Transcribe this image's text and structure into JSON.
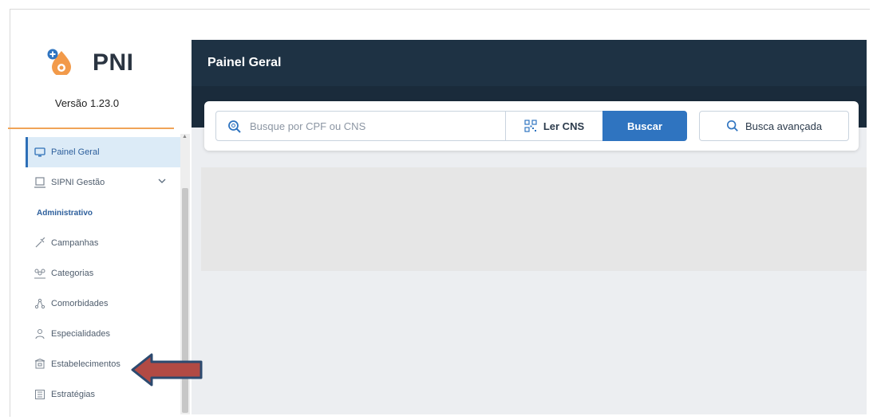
{
  "app": {
    "logo_text": "PNI",
    "version": "Versão 1.23.0"
  },
  "sidebar": {
    "items": [
      {
        "label": "Painel Geral",
        "icon": "monitor-icon",
        "active": true
      },
      {
        "label": "SIPNI Gestão",
        "icon": "laptop-icon",
        "expandable": true
      },
      {
        "label": "Campanhas",
        "icon": "syringe-icon"
      },
      {
        "label": "Categorias",
        "icon": "people-group-icon"
      },
      {
        "label": "Comorbidades",
        "icon": "share-nodes-icon"
      },
      {
        "label": "Especialidades",
        "icon": "doctor-icon"
      },
      {
        "label": "Estabelecimentos",
        "icon": "building-icon"
      },
      {
        "label": "Estratégias",
        "icon": "strategy-icon"
      }
    ],
    "section_label": "Administrativo"
  },
  "header": {
    "title": "Painel Geral"
  },
  "search": {
    "placeholder": "Busque por CPF ou CNS",
    "value": "",
    "read_cns_label": "Ler CNS",
    "search_button_label": "Buscar",
    "advanced_label": "Busca avançada"
  },
  "colors": {
    "header_bg": "#1e3244",
    "accent_orange": "#f0a458",
    "primary_blue": "#2f74c0",
    "active_item_bg": "#dcebf7",
    "arrow_fill": "#b24a44",
    "arrow_stroke": "#2c4a6f"
  }
}
